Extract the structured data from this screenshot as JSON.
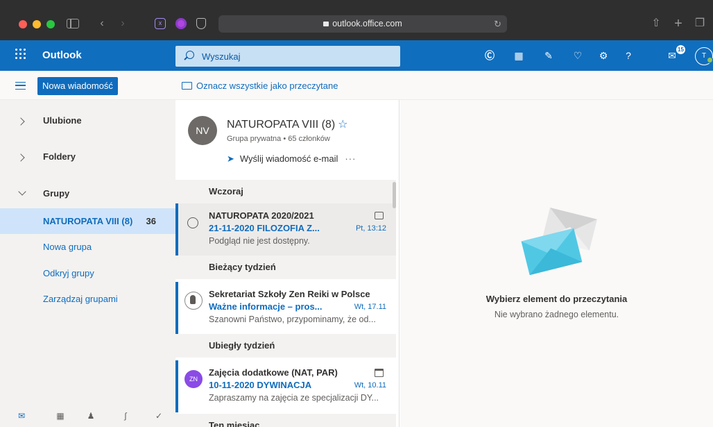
{
  "browser": {
    "url": "outlook.office.com"
  },
  "header": {
    "app_name": "Outlook",
    "search_placeholder": "Wyszukaj",
    "notification_count": "15",
    "avatar_initial": "T"
  },
  "commandbar": {
    "new_message": "Nowa wiadomość",
    "mark_all_read": "Oznacz wszystkie jako przeczytane"
  },
  "leftnav": {
    "favorites": "Ulubione",
    "folders": "Foldery",
    "groups": "Grupy",
    "group_items": [
      {
        "label": "NATUROPATA VIII (8)",
        "count": "36"
      },
      {
        "label": "Nowa grupa"
      },
      {
        "label": "Odkryj grupy"
      },
      {
        "label": "Zarządzaj grupami"
      }
    ]
  },
  "group_header": {
    "initials": "NV",
    "title": "NATUROPATA VIII (8)",
    "type": "Grupa prywatna",
    "members": "65 członków",
    "send_email": "Wyślij wiadomość e-mail"
  },
  "list": {
    "sections": [
      "Wczoraj",
      "Bieżący tydzień",
      "Ubiegły tydzień",
      "Ten miesiąc"
    ],
    "messages": [
      {
        "sender": "NATUROPATA 2020/2021",
        "subject": "21-11-2020 FILOZOFIA Z...",
        "time": "Pt, 13:12",
        "preview": "Podgląd nie jest dostępny."
      },
      {
        "sender": "Sekretariat Szkoły Zen Reiki w Polsce",
        "subject": "Ważne informacje – pros...",
        "time": "Wt, 17.11",
        "preview": "Szanowni Państwo, przypominamy, że od..."
      },
      {
        "sender": "Zajęcia dodatkowe (NAT, PAR)",
        "subject": "10-11-2020 DYWINACJA",
        "time": "Wt, 10.11",
        "preview": "Zapraszamy na zajęcia ze specjalizacji DY...",
        "avatar": "ZN"
      }
    ]
  },
  "reading": {
    "title": "Wybierz element do przeczytania",
    "subtitle": "Nie wybrano żadnego elementu."
  }
}
